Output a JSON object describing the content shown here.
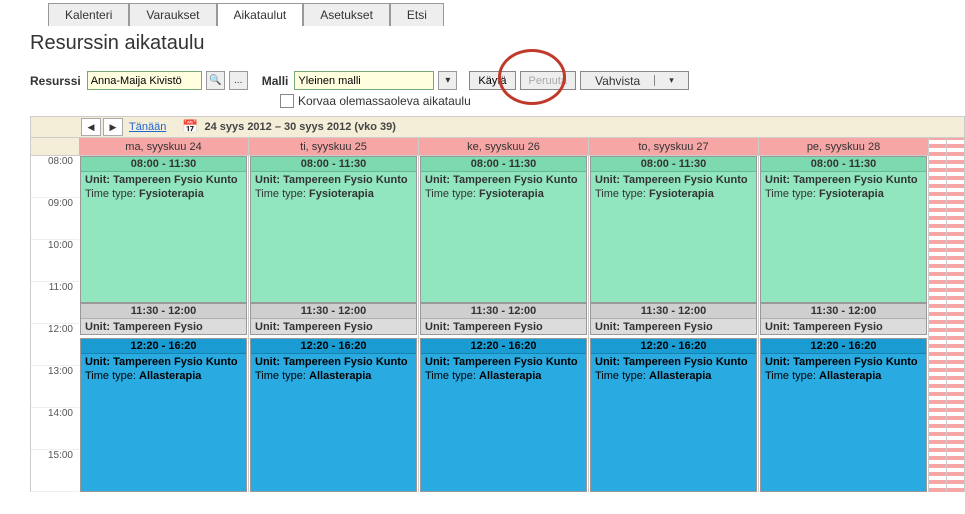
{
  "tabs": {
    "items": [
      "Kalenteri",
      "Varaukset",
      "Aikataulut",
      "Asetukset",
      "Etsi"
    ],
    "active_index": 2
  },
  "page_title": "Resurssin aikataulu",
  "controls": {
    "resurssi_label": "Resurssi",
    "resurssi_value": "Anna-Maija Kivistö",
    "ellipsis": "...",
    "malli_label": "Malli",
    "malli_value": "Yleinen malli",
    "apply_label": "Käytä",
    "cancel_label": "Peruuta",
    "confirm_label": "Vahvista",
    "overwrite_label": "Korvaa olemassaoleva aikataulu"
  },
  "calendar": {
    "prev": "◀",
    "next": "▶",
    "today_label": "Tänään",
    "range_label": "24 syys 2012 – 30 syys 2012 (vko 39)",
    "time_labels": [
      "08:00",
      "09:00",
      "10:00",
      "11:00",
      "12:00",
      "13:00",
      "14:00",
      "15:00"
    ],
    "days": [
      {
        "header": "ma, syyskuu 24"
      },
      {
        "header": "ti, syyskuu 25"
      },
      {
        "header": "ke, syyskuu 26"
      },
      {
        "header": "to, syyskuu 27"
      },
      {
        "header": "pe, syyskuu 28"
      }
    ],
    "template_events": {
      "morning": {
        "time": "08:00 - 11:30",
        "unit_label": "Unit:",
        "unit": "Tampereen Fysio Kunto",
        "type_label": "Time type:",
        "type": "Fysioterapia"
      },
      "lunch": {
        "time": "11:30 - 12:00",
        "unit_label": "Unit:",
        "unit": "Tampereen Fysio"
      },
      "afternoon": {
        "time": "12:20 - 16:20",
        "unit_label": "Unit:",
        "unit": "Tampereen Fysio Kunto",
        "type_label": "Time type:",
        "type": "Allasterapia"
      }
    }
  }
}
